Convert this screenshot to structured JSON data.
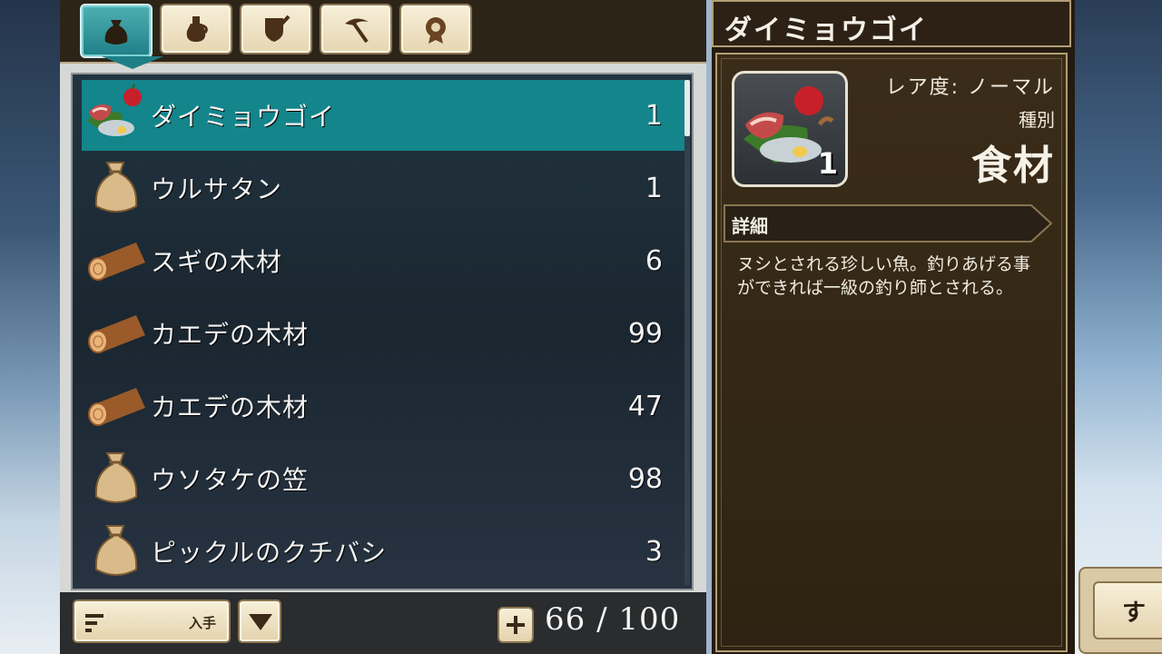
{
  "tabs": [
    {
      "name": "bag",
      "icon": "bag-icon",
      "active": true
    },
    {
      "name": "potion",
      "icon": "potion-icon",
      "active": false
    },
    {
      "name": "equipment",
      "icon": "shield-sword-icon",
      "active": false
    },
    {
      "name": "tools",
      "icon": "pickaxe-icon",
      "active": false
    },
    {
      "name": "medal",
      "icon": "medal-icon",
      "active": false
    }
  ],
  "items": [
    {
      "name": "ダイミョウゴイ",
      "count": "1",
      "icon": "food-icon",
      "selected": true
    },
    {
      "name": "ウルサタン",
      "count": "1",
      "icon": "sack-icon",
      "selected": false
    },
    {
      "name": "スギの木材",
      "count": "6",
      "icon": "log-icon",
      "selected": false
    },
    {
      "name": "カエデの木材",
      "count": "99",
      "icon": "log-icon",
      "selected": false
    },
    {
      "name": "カエデの木材",
      "count": "47",
      "icon": "log-icon",
      "selected": false
    },
    {
      "name": "ウソタケの笠",
      "count": "98",
      "icon": "sack-icon",
      "selected": false
    },
    {
      "name": "ピックルのクチバシ",
      "count": "3",
      "icon": "sack-icon",
      "selected": false
    }
  ],
  "sort": {
    "label": "入手"
  },
  "capacity": "66 / 100",
  "detail": {
    "title": "ダイミョウゴイ",
    "quantity": "1",
    "rarity": "レア度: ノーマル",
    "type_label": "種別",
    "type_value": "食材",
    "section_label": "詳細",
    "description": "ヌシとされる珍しい魚。釣りあげる事ができれば一級の釣り師とされる。"
  },
  "partial_button": {
    "label": "す"
  },
  "colors": {
    "selected_row": "#13858b",
    "active_tab": "#1f7f86",
    "panel_brown": "#2e2312",
    "tab_cream": "#f7efd9"
  }
}
